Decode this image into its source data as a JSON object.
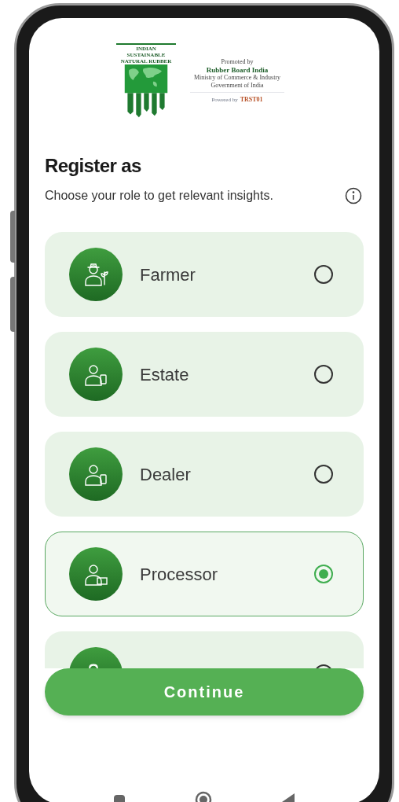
{
  "logo": {
    "badge_text": "INDIAN SUSTAINABLE NATURAL RUBBER",
    "lines": [
      "Promoted by",
      "Rubber Board India",
      "Ministry of Commerce & Industry",
      "Government of India"
    ],
    "powered_by": "Powered by",
    "powered_brand": "TRST01"
  },
  "title": "Register as",
  "subtitle": "Choose your role to get relevant insights.",
  "roles": [
    {
      "label": "Farmer",
      "selected": false
    },
    {
      "label": "Estate",
      "selected": false
    },
    {
      "label": "Dealer",
      "selected": false
    },
    {
      "label": "Processor",
      "selected": true
    },
    {
      "selected": false
    }
  ],
  "continue_button": "Continue"
}
